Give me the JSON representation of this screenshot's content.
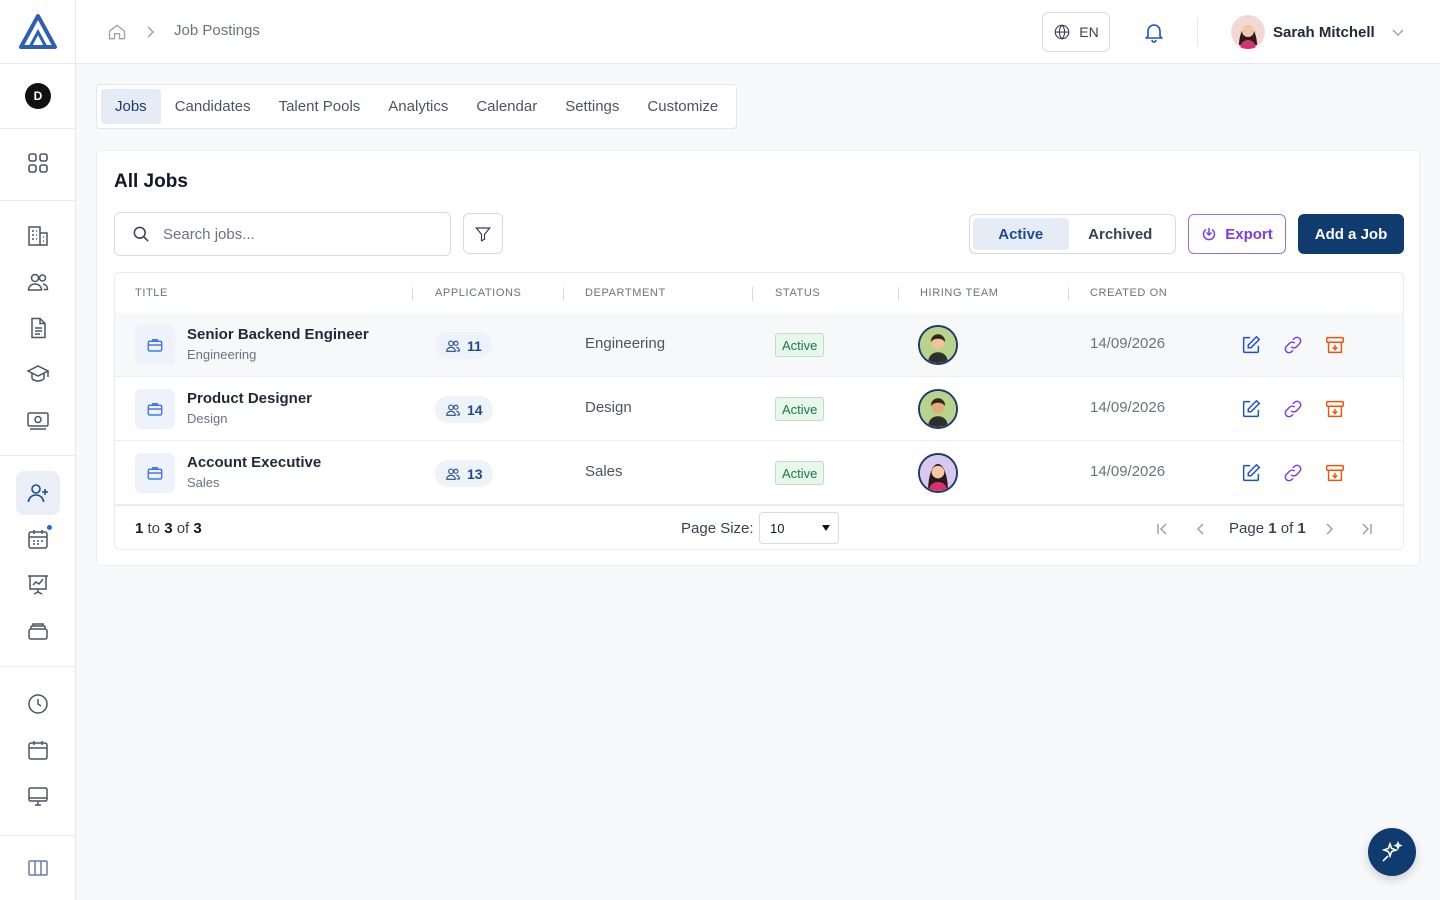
{
  "header": {
    "breadcrumb_title": "Job Postings",
    "language": "EN",
    "user_name": "Sarah Mitchell"
  },
  "sidebar": {
    "org_initial": "D",
    "items": [
      {
        "name": "dashboard",
        "icon": "grid-icon"
      },
      {
        "name": "company",
        "icon": "building-icon"
      },
      {
        "name": "people",
        "icon": "users-icon"
      },
      {
        "name": "documents",
        "icon": "document-icon"
      },
      {
        "name": "learning",
        "icon": "graduation-cap-icon"
      },
      {
        "name": "payroll",
        "icon": "money-icon"
      },
      {
        "name": "recruitment",
        "icon": "user-plus-icon",
        "active": true
      },
      {
        "name": "calendar-events",
        "icon": "calendar-icon",
        "notification": true
      },
      {
        "name": "performance",
        "icon": "presentation-chart-icon"
      },
      {
        "name": "assets",
        "icon": "stack-icon"
      },
      {
        "name": "time-tracking",
        "icon": "clock-icon"
      },
      {
        "name": "schedule",
        "icon": "calendar-icon"
      },
      {
        "name": "devices",
        "icon": "monitor-icon"
      }
    ]
  },
  "tabs": [
    {
      "label": "Jobs",
      "active": true
    },
    {
      "label": "Candidates"
    },
    {
      "label": "Talent Pools"
    },
    {
      "label": "Analytics"
    },
    {
      "label": "Calendar"
    },
    {
      "label": "Settings"
    },
    {
      "label": "Customize"
    }
  ],
  "jobs_card": {
    "title": "All Jobs",
    "search_placeholder": "Search jobs...",
    "segment": {
      "active": "Active",
      "archived": "Archived",
      "selected": "Active"
    },
    "export_label": "Export",
    "add_label": "Add a Job"
  },
  "table": {
    "columns": [
      "TITLE",
      "APPLICATIONS",
      "DEPARTMENT",
      "STATUS",
      "HIRING TEAM",
      "CREATED ON"
    ],
    "rows": [
      {
        "title": "Senior Backend Engineer",
        "subtitle": "Engineering",
        "applications": "11",
        "department": "Engineering",
        "status": "Active",
        "hiring_team": "male-avatar",
        "created_on": "14/09/2026"
      },
      {
        "title": "Product Designer",
        "subtitle": "Design",
        "applications": "14",
        "department": "Design",
        "status": "Active",
        "hiring_team": "male-avatar",
        "created_on": "14/09/2026"
      },
      {
        "title": "Account Executive",
        "subtitle": "Sales",
        "applications": "13",
        "department": "Sales",
        "status": "Active",
        "hiring_team": "female-avatar",
        "created_on": "14/09/2026"
      }
    ],
    "footer": {
      "range_start": "1",
      "range_end": "3",
      "total": "3",
      "page_size_label": "Page Size:",
      "page_size": "10",
      "page_label": "Page",
      "page_current": "1",
      "page_total": "1"
    }
  },
  "colors": {
    "primary": "#0f3b6e",
    "status_active": "#16803c",
    "export_accent": "#7c3aed",
    "archive_accent": "#ea580c",
    "link_accent": "#7c3aed",
    "edit_accent": "#1d4ed8"
  }
}
